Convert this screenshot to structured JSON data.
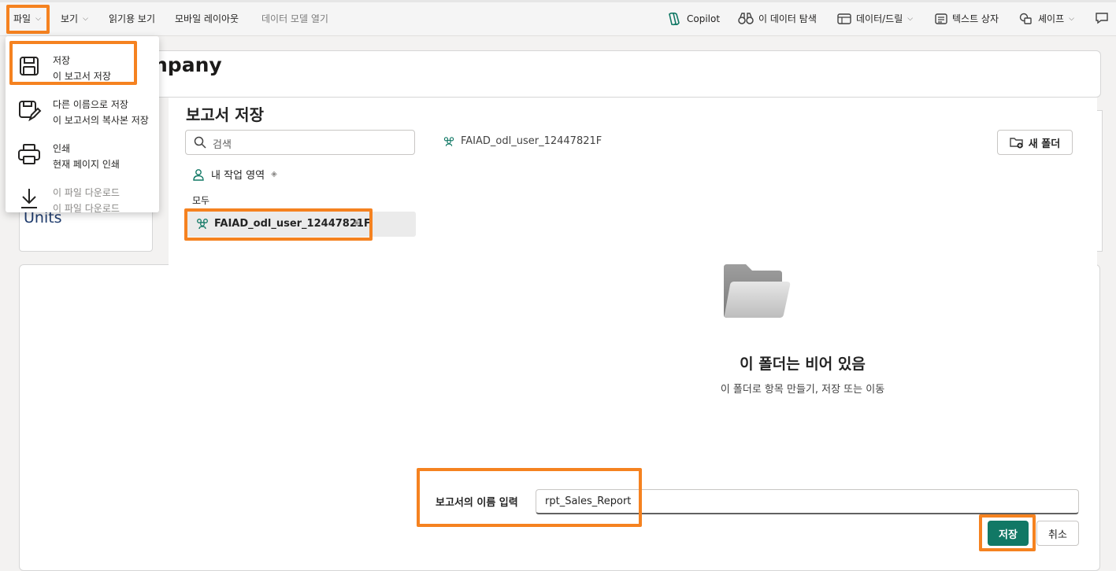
{
  "ribbon": {
    "file": "파일",
    "view": "보기",
    "reading_view": "읽기용 보기",
    "mobile_layout": "모바일 레이아웃",
    "open_data_model": "데이터 모델 열기",
    "copilot": "Copilot",
    "explore_data": "이 데이터 탐색",
    "data_drill": "데이터/드릴",
    "text_box": "텍스트 상자",
    "shapes": "셰이프"
  },
  "file_menu": {
    "items": [
      {
        "title": "저장",
        "subtitle": "이 보고서 저장",
        "icon": "save-icon"
      },
      {
        "title": "다른 이름으로 저장",
        "subtitle": "이 보고서의 복사본 저장",
        "icon": "save-as-icon"
      },
      {
        "title": "인쇄",
        "subtitle": "현재 페이지 인쇄",
        "icon": "print-icon"
      },
      {
        "title": "이 파일 다운로드",
        "subtitle": "이 파일 다운로드",
        "icon": "download-icon"
      }
    ]
  },
  "report": {
    "title_fragment": "npany",
    "card_label": "Units"
  },
  "dialog": {
    "title": "보고서 저장",
    "search_placeholder": "검색",
    "my_workspace": "내 작업 영역",
    "all_label": "모두",
    "selected_workspace": "FAIAD_odl_user_12447821F",
    "current_location": "FAIAD_odl_user_12447821F",
    "new_folder": "새 폴더",
    "empty_title": "이 폴더는 비어 있음",
    "empty_subtitle": "이 폴더로 항목 만들기, 저장 또는 이동",
    "name_label": "보고서의 이름 입력",
    "name_value": "rpt_Sales_Report",
    "save_button": "저장",
    "cancel_button": "취소"
  },
  "colors": {
    "highlight": "#f58220",
    "primary_button": "#117865",
    "workspace_icon": "#117865"
  }
}
